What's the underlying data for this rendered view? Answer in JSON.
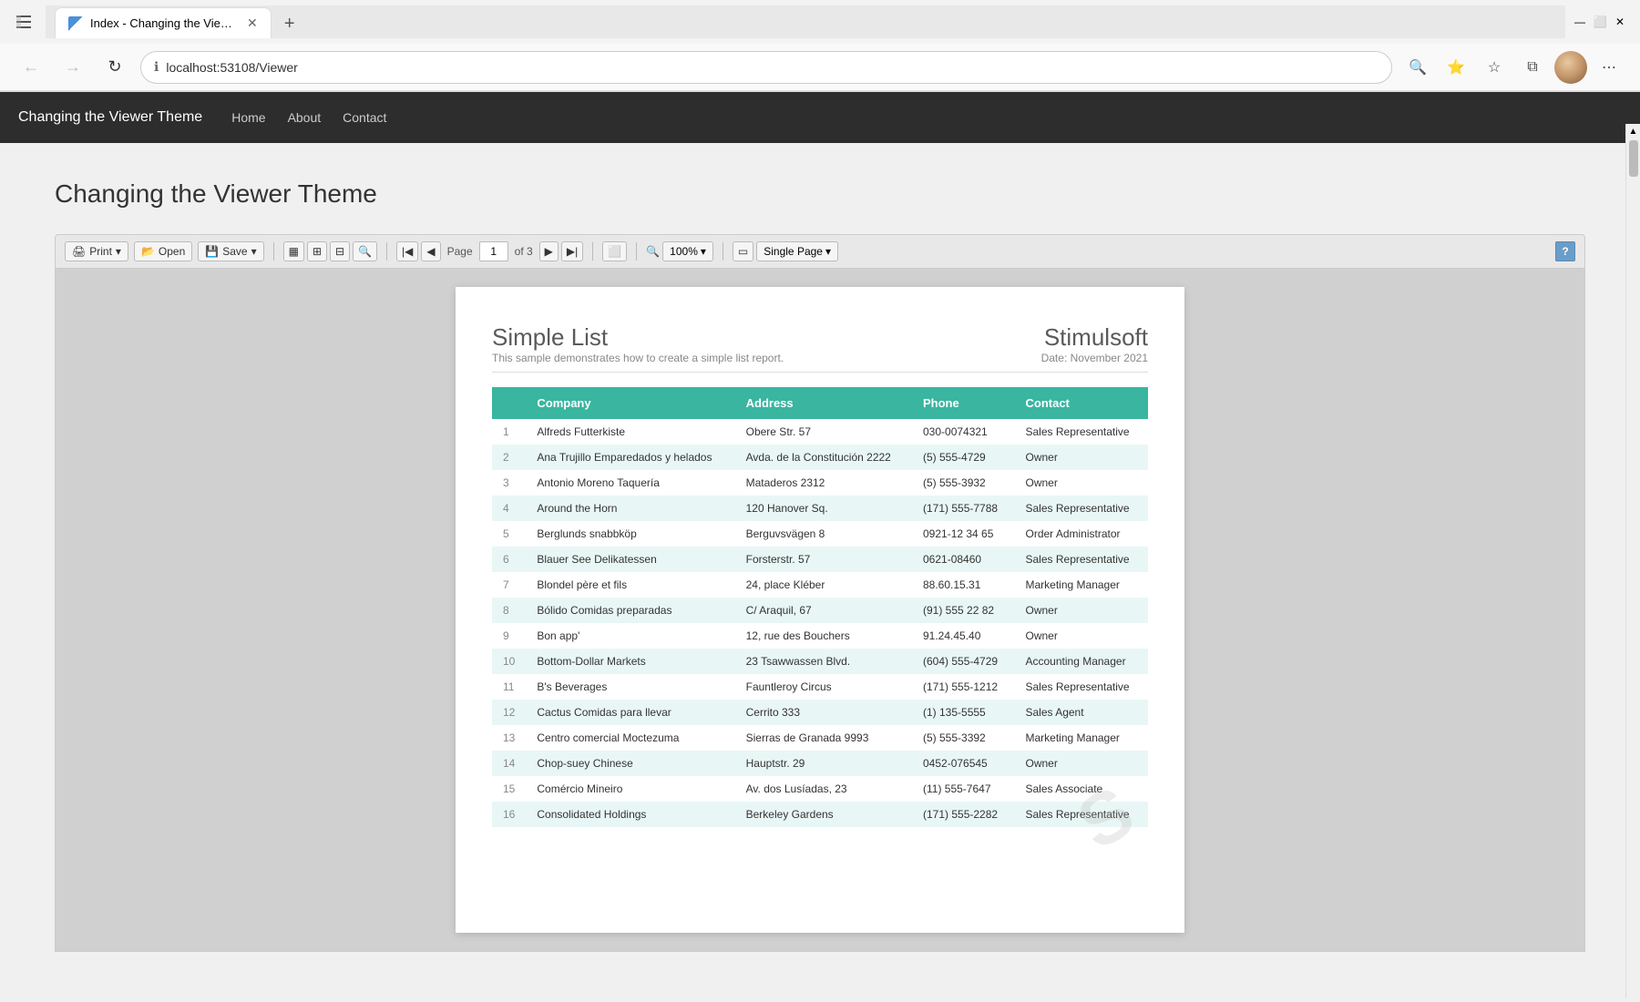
{
  "browser": {
    "tab_title": "Index - Changing the Viewer Th",
    "url": "localhost:53108/Viewer",
    "new_tab_label": "+"
  },
  "nav": {
    "brand": "Changing the Viewer Theme",
    "links": [
      "Home",
      "About",
      "Contact"
    ]
  },
  "page": {
    "title": "Changing the Viewer Theme"
  },
  "toolbar": {
    "print_label": "Print",
    "open_label": "Open",
    "save_label": "Save",
    "page_label": "Page",
    "page_value": "1",
    "page_of": "of 3",
    "zoom_label": "100%",
    "view_label": "Single Page",
    "help_label": "?"
  },
  "report": {
    "title": "Simple List",
    "brand": "Stimulsoft",
    "subtitle": "This sample demonstrates how to create a simple list report.",
    "date_label": "Date: November 2021",
    "columns": [
      "Company",
      "Address",
      "Phone",
      "Contact"
    ],
    "rows": [
      {
        "num": "1",
        "company": "Alfreds Futterkiste",
        "address": "Obere Str. 57",
        "phone": "030-0074321",
        "contact": "Sales Representative"
      },
      {
        "num": "2",
        "company": "Ana Trujillo Emparedados y helados",
        "address": "Avda. de la Constitución 2222",
        "phone": "(5) 555-4729",
        "contact": "Owner"
      },
      {
        "num": "3",
        "company": "Antonio Moreno Taquería",
        "address": "Mataderos  2312",
        "phone": "(5) 555-3932",
        "contact": "Owner"
      },
      {
        "num": "4",
        "company": "Around the Horn",
        "address": "120 Hanover Sq.",
        "phone": "(171) 555-7788",
        "contact": "Sales Representative"
      },
      {
        "num": "5",
        "company": "Berglunds snabbköp",
        "address": "Berguvsvägen  8",
        "phone": "0921-12 34 65",
        "contact": "Order Administrator"
      },
      {
        "num": "6",
        "company": "Blauer See Delikatessen",
        "address": "Forsterstr. 57",
        "phone": "0621-08460",
        "contact": "Sales Representative"
      },
      {
        "num": "7",
        "company": "Blondel père et fils",
        "address": "24, place Kléber",
        "phone": "88.60.15.31",
        "contact": "Marketing Manager"
      },
      {
        "num": "8",
        "company": "Bólido Comidas preparadas",
        "address": "C/ Araquil, 67",
        "phone": "(91) 555 22 82",
        "contact": "Owner"
      },
      {
        "num": "9",
        "company": "Bon app'",
        "address": "12, rue des Bouchers",
        "phone": "91.24.45.40",
        "contact": "Owner"
      },
      {
        "num": "10",
        "company": "Bottom-Dollar Markets",
        "address": "23 Tsawwassen Blvd.",
        "phone": "(604) 555-4729",
        "contact": "Accounting Manager"
      },
      {
        "num": "11",
        "company": "B's Beverages",
        "address": "Fauntleroy Circus",
        "phone": "(171) 555-1212",
        "contact": "Sales Representative"
      },
      {
        "num": "12",
        "company": "Cactus Comidas para llevar",
        "address": "Cerrito 333",
        "phone": "(1) 135-5555",
        "contact": "Sales Agent"
      },
      {
        "num": "13",
        "company": "Centro comercial Moctezuma",
        "address": "Sierras de Granada 9993",
        "phone": "(5) 555-3392",
        "contact": "Marketing Manager"
      },
      {
        "num": "14",
        "company": "Chop-suey Chinese",
        "address": "Hauptstr. 29",
        "phone": "0452-076545",
        "contact": "Owner"
      },
      {
        "num": "15",
        "company": "Comércio Mineiro",
        "address": "Av. dos Lusíadas, 23",
        "phone": "(11) 555-7647",
        "contact": "Sales Associate"
      },
      {
        "num": "16",
        "company": "Consolidated Holdings",
        "address": "Berkeley Gardens",
        "phone": "(171) 555-2282",
        "contact": "Sales Representative"
      }
    ]
  }
}
